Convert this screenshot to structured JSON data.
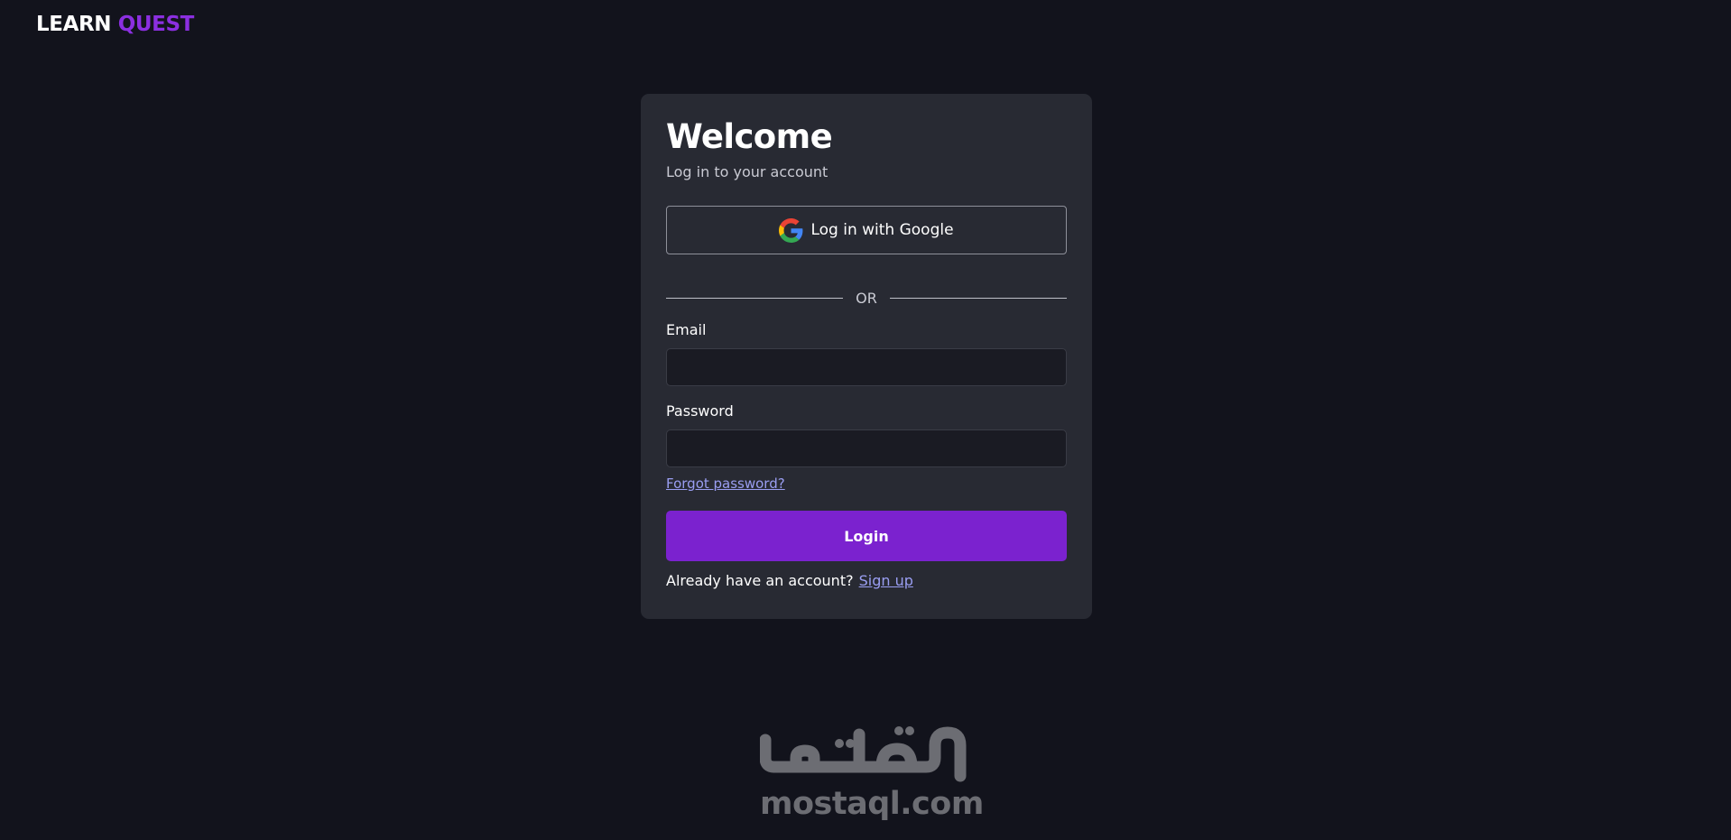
{
  "header": {
    "brand_part1": "LEARN",
    "brand_part2": "QUEST"
  },
  "login_card": {
    "title": "Welcome",
    "subtitle": "Log in to your account",
    "google_button_label": "Log in with Google",
    "divider_text": "OR",
    "email_label": "Email",
    "email_value": "",
    "password_label": "Password",
    "password_value": "",
    "forgot_password_link": "Forgot password?",
    "login_button_label": "Login",
    "signup_prompt": "Already have an account?",
    "signup_link": "Sign up"
  },
  "watermark": {
    "arabic_text": "مستقل",
    "domain": "mostaql.com"
  },
  "colors": {
    "background": "#12131c",
    "card": "#282a33",
    "accent": "#7b22cf",
    "brand_accent": "#8b2fe0",
    "link": "#9a9ef2"
  },
  "icons": {
    "google_button_icon": "google-g-icon"
  }
}
